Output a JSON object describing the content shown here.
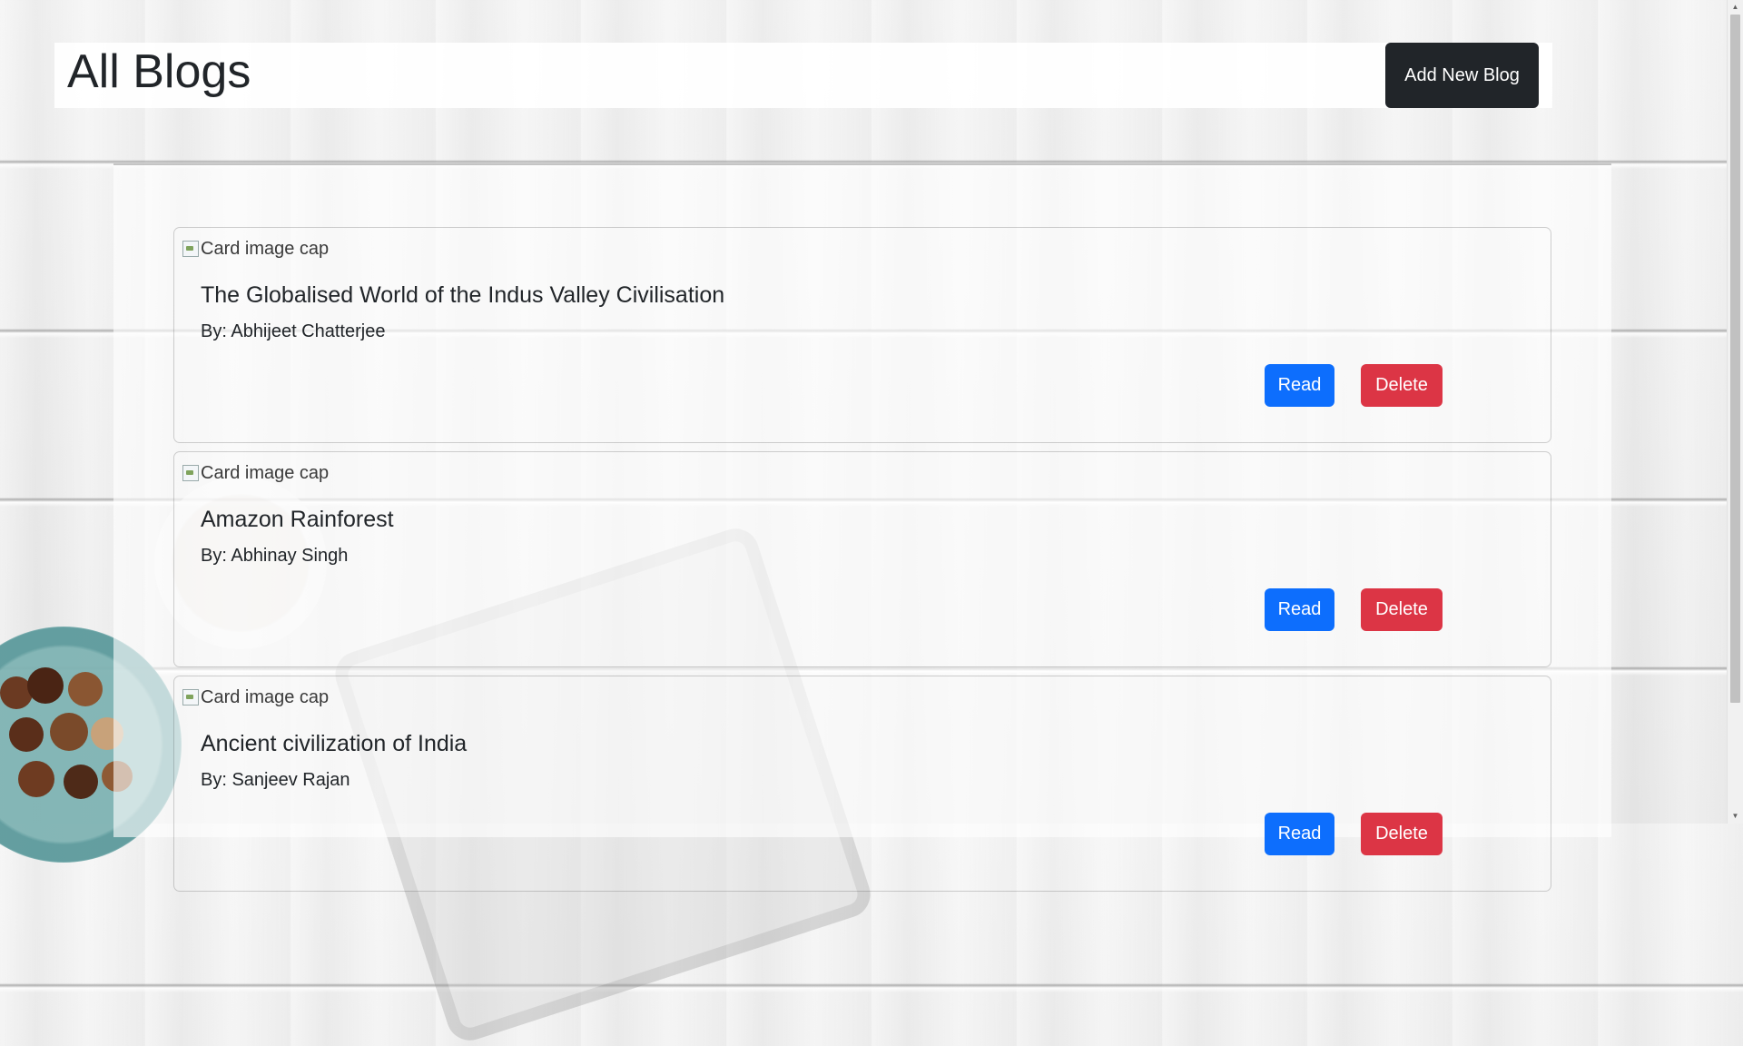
{
  "header": {
    "title": "All Blogs",
    "add_button_label": "Add New Blog"
  },
  "blogs": [
    {
      "image_alt": "Card image cap",
      "title": "The Globalised World of the Indus Valley Civilisation",
      "author": "By: Abhijeet Chatterjee",
      "read_label": "Read",
      "delete_label": "Delete"
    },
    {
      "image_alt": "Card image cap",
      "title": "Amazon Rainforest",
      "author": "By: Abhinay Singh",
      "read_label": "Read",
      "delete_label": "Delete"
    },
    {
      "image_alt": "Card image cap",
      "title": "Ancient civilization of India",
      "author": "By: Sanjeev Rajan",
      "read_label": "Read",
      "delete_label": "Delete"
    }
  ],
  "colors": {
    "primary": "#0d6efd",
    "danger": "#dc3545",
    "dark": "#212529"
  }
}
